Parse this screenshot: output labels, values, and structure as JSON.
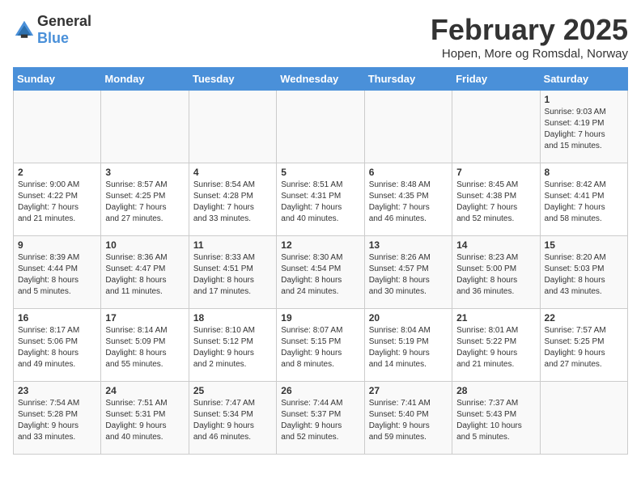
{
  "header": {
    "logo_general": "General",
    "logo_blue": "Blue",
    "month_title": "February 2025",
    "location": "Hopen, More og Romsdal, Norway"
  },
  "days_of_week": [
    "Sunday",
    "Monday",
    "Tuesday",
    "Wednesday",
    "Thursday",
    "Friday",
    "Saturday"
  ],
  "weeks": [
    [
      {
        "day": "",
        "info": ""
      },
      {
        "day": "",
        "info": ""
      },
      {
        "day": "",
        "info": ""
      },
      {
        "day": "",
        "info": ""
      },
      {
        "day": "",
        "info": ""
      },
      {
        "day": "",
        "info": ""
      },
      {
        "day": "1",
        "info": "Sunrise: 9:03 AM\nSunset: 4:19 PM\nDaylight: 7 hours\nand 15 minutes."
      }
    ],
    [
      {
        "day": "2",
        "info": "Sunrise: 9:00 AM\nSunset: 4:22 PM\nDaylight: 7 hours\nand 21 minutes."
      },
      {
        "day": "3",
        "info": "Sunrise: 8:57 AM\nSunset: 4:25 PM\nDaylight: 7 hours\nand 27 minutes."
      },
      {
        "day": "4",
        "info": "Sunrise: 8:54 AM\nSunset: 4:28 PM\nDaylight: 7 hours\nand 33 minutes."
      },
      {
        "day": "5",
        "info": "Sunrise: 8:51 AM\nSunset: 4:31 PM\nDaylight: 7 hours\nand 40 minutes."
      },
      {
        "day": "6",
        "info": "Sunrise: 8:48 AM\nSunset: 4:35 PM\nDaylight: 7 hours\nand 46 minutes."
      },
      {
        "day": "7",
        "info": "Sunrise: 8:45 AM\nSunset: 4:38 PM\nDaylight: 7 hours\nand 52 minutes."
      },
      {
        "day": "8",
        "info": "Sunrise: 8:42 AM\nSunset: 4:41 PM\nDaylight: 7 hours\nand 58 minutes."
      }
    ],
    [
      {
        "day": "9",
        "info": "Sunrise: 8:39 AM\nSunset: 4:44 PM\nDaylight: 8 hours\nand 5 minutes."
      },
      {
        "day": "10",
        "info": "Sunrise: 8:36 AM\nSunset: 4:47 PM\nDaylight: 8 hours\nand 11 minutes."
      },
      {
        "day": "11",
        "info": "Sunrise: 8:33 AM\nSunset: 4:51 PM\nDaylight: 8 hours\nand 17 minutes."
      },
      {
        "day": "12",
        "info": "Sunrise: 8:30 AM\nSunset: 4:54 PM\nDaylight: 8 hours\nand 24 minutes."
      },
      {
        "day": "13",
        "info": "Sunrise: 8:26 AM\nSunset: 4:57 PM\nDaylight: 8 hours\nand 30 minutes."
      },
      {
        "day": "14",
        "info": "Sunrise: 8:23 AM\nSunset: 5:00 PM\nDaylight: 8 hours\nand 36 minutes."
      },
      {
        "day": "15",
        "info": "Sunrise: 8:20 AM\nSunset: 5:03 PM\nDaylight: 8 hours\nand 43 minutes."
      }
    ],
    [
      {
        "day": "16",
        "info": "Sunrise: 8:17 AM\nSunset: 5:06 PM\nDaylight: 8 hours\nand 49 minutes."
      },
      {
        "day": "17",
        "info": "Sunrise: 8:14 AM\nSunset: 5:09 PM\nDaylight: 8 hours\nand 55 minutes."
      },
      {
        "day": "18",
        "info": "Sunrise: 8:10 AM\nSunset: 5:12 PM\nDaylight: 9 hours\nand 2 minutes."
      },
      {
        "day": "19",
        "info": "Sunrise: 8:07 AM\nSunset: 5:15 PM\nDaylight: 9 hours\nand 8 minutes."
      },
      {
        "day": "20",
        "info": "Sunrise: 8:04 AM\nSunset: 5:19 PM\nDaylight: 9 hours\nand 14 minutes."
      },
      {
        "day": "21",
        "info": "Sunrise: 8:01 AM\nSunset: 5:22 PM\nDaylight: 9 hours\nand 21 minutes."
      },
      {
        "day": "22",
        "info": "Sunrise: 7:57 AM\nSunset: 5:25 PM\nDaylight: 9 hours\nand 27 minutes."
      }
    ],
    [
      {
        "day": "23",
        "info": "Sunrise: 7:54 AM\nSunset: 5:28 PM\nDaylight: 9 hours\nand 33 minutes."
      },
      {
        "day": "24",
        "info": "Sunrise: 7:51 AM\nSunset: 5:31 PM\nDaylight: 9 hours\nand 40 minutes."
      },
      {
        "day": "25",
        "info": "Sunrise: 7:47 AM\nSunset: 5:34 PM\nDaylight: 9 hours\nand 46 minutes."
      },
      {
        "day": "26",
        "info": "Sunrise: 7:44 AM\nSunset: 5:37 PM\nDaylight: 9 hours\nand 52 minutes."
      },
      {
        "day": "27",
        "info": "Sunrise: 7:41 AM\nSunset: 5:40 PM\nDaylight: 9 hours\nand 59 minutes."
      },
      {
        "day": "28",
        "info": "Sunrise: 7:37 AM\nSunset: 5:43 PM\nDaylight: 10 hours\nand 5 minutes."
      },
      {
        "day": "",
        "info": ""
      }
    ]
  ]
}
